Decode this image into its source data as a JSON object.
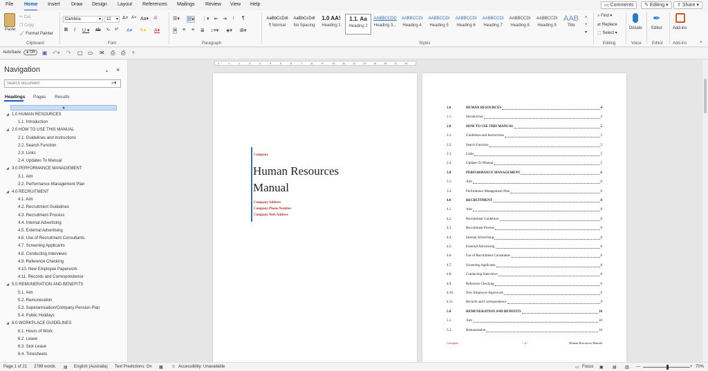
{
  "menus": [
    "File",
    "Home",
    "Insert",
    "Draw",
    "Design",
    "Layout",
    "References",
    "Mailings",
    "Review",
    "View",
    "Help"
  ],
  "top_buttons": {
    "comments": "Comments",
    "editing": "Editing",
    "share": "Share"
  },
  "ribbon": {
    "clipboard": {
      "paste": "Paste",
      "cut": "Cut",
      "copy": "Copy",
      "format_painter": "Format Painter",
      "label": "Clipboard"
    },
    "font": {
      "name": "Cambria",
      "size": "12",
      "label": "Font"
    },
    "paragraph": {
      "label": "Paragraph"
    },
    "styles": {
      "label": "Styles",
      "items": [
        {
          "preview": "AaBbCcDdI",
          "name": "¶ Normal"
        },
        {
          "preview": "AaBbCcDdI",
          "name": "No Spacing"
        },
        {
          "preview": "1.0 AA!",
          "name": "Heading 1"
        },
        {
          "preview": "1.1. Aa",
          "name": "Heading 2"
        },
        {
          "preview": "AABBCCDD",
          "name": "Heading 3..."
        },
        {
          "preview": "AABBCCDI",
          "name": "Heading 4"
        },
        {
          "preview": "AABBCCDI",
          "name": "Heading 5"
        },
        {
          "preview": "AABBCCDI",
          "name": "Heading 6"
        },
        {
          "preview": "AABBCCDI",
          "name": "Heading 7"
        },
        {
          "preview": "AABBCCDI",
          "name": "Heading 8"
        },
        {
          "preview": "AABBCCDI",
          "name": "Heading 9"
        },
        {
          "preview": "AAB",
          "name": "Title"
        }
      ]
    },
    "editing": {
      "find": "Find",
      "replace": "Replace",
      "select": "Select",
      "label": "Editing"
    },
    "voice": {
      "dictate": "Dictate",
      "label": "Voice"
    },
    "editor": {
      "editor": "Editor",
      "label": "Editor"
    },
    "addins": {
      "addins": "Add-ins",
      "label": "Add-ins"
    }
  },
  "qat": {
    "autosave": "AutoSave",
    "toggle": "Off"
  },
  "navigation": {
    "title": "Navigation",
    "search_placeholder": "Search document",
    "tabs": [
      "Headings",
      "Pages",
      "Results"
    ],
    "headings": [
      {
        "text": "1.0 HUMAN RESOURCES",
        "level": 1
      },
      {
        "text": "1.1. Introduction",
        "level": 2
      },
      {
        "text": "2.0 HOW TO USE THIS MANUAL",
        "level": 1
      },
      {
        "text": "2.1. Guidelines and Instructions",
        "level": 2
      },
      {
        "text": "2.2. Search Function",
        "level": 2
      },
      {
        "text": "2.3. Links",
        "level": 2
      },
      {
        "text": "2.4. Updates To Manual",
        "level": 2
      },
      {
        "text": "3.0 PERFORMANCE MANAGEMENT",
        "level": 1
      },
      {
        "text": "3.1. Aim",
        "level": 2
      },
      {
        "text": "3.2. Performance Management Plan",
        "level": 2
      },
      {
        "text": "4.0 RECRUITMENT",
        "level": 1
      },
      {
        "text": "4.1. Aim",
        "level": 2
      },
      {
        "text": "4.2. Recruitment Guidelines",
        "level": 2
      },
      {
        "text": "4.3. Recruitment Process",
        "level": 2
      },
      {
        "text": "4.4. Internal Advertising",
        "level": 2
      },
      {
        "text": "4.5. External Advertising",
        "level": 2
      },
      {
        "text": "4.6. Use of Recruitment Consultants",
        "level": 2
      },
      {
        "text": "4.7. Screening Applicants",
        "level": 2
      },
      {
        "text": "4.8. Conducting Interviews",
        "level": 2
      },
      {
        "text": "4.9. Reference Checking",
        "level": 2
      },
      {
        "text": "4.10. New Employee Paperwork",
        "level": 2
      },
      {
        "text": "4.11. Records  and Correspondence",
        "level": 2
      },
      {
        "text": "5.0 REMUNERATION AND BENEFITS",
        "level": 1
      },
      {
        "text": "5.1. Aim",
        "level": 2
      },
      {
        "text": "5.2. Remuneration",
        "level": 2
      },
      {
        "text": "5.3. Superannuation/Company Pension Plan",
        "level": 2
      },
      {
        "text": "5.4. Public Holidays",
        "level": 2
      },
      {
        "text": "6.0 WORKPLACE  GUIDELINES",
        "level": 1
      },
      {
        "text": "6.1. Hours of Work",
        "level": 2
      },
      {
        "text": "6.2. Leave",
        "level": 2
      },
      {
        "text": "6.3. Sick Leave",
        "level": 2
      },
      {
        "text": "6.4. Timesheets",
        "level": 2
      }
    ]
  },
  "ruler_marks": [
    "2",
    "1",
    "1",
    "2",
    "3",
    "4",
    "5",
    "6",
    "7",
    "8",
    "9",
    "10",
    "11",
    "12",
    "13",
    "14",
    "15",
    "17",
    "18"
  ],
  "cover": {
    "company": "Company",
    "title_line1": "Human Resources",
    "title_line2": "Manual",
    "address": "Company Address",
    "phone": "Company Phone Number",
    "web": "Company Web Address"
  },
  "toc": [
    {
      "num": "1.0",
      "title": "HUMAN RESOURCES",
      "page": "4",
      "bold": true
    },
    {
      "num": "1.1.",
      "title": "Introduction",
      "page": "4",
      "bold": false
    },
    {
      "num": "2.0",
      "title": "HOW TO USE THIS MANUAL",
      "page": "5",
      "bold": true
    },
    {
      "num": "2.1.",
      "title": "Guidelines and Instructions",
      "page": "5",
      "bold": false
    },
    {
      "num": "2.2.",
      "title": "Search Function",
      "page": "5",
      "bold": false
    },
    {
      "num": "2.3.",
      "title": "Links",
      "page": "5",
      "bold": false
    },
    {
      "num": "2.4.",
      "title": "Updates To Manual",
      "page": "5",
      "bold": false
    },
    {
      "num": "3.0",
      "title": "PERFORMANCE MANAGEMENT",
      "page": "6",
      "bold": true
    },
    {
      "num": "3.1.",
      "title": "Aim",
      "page": "6",
      "bold": false
    },
    {
      "num": "3.2.",
      "title": "Performance Management Plan",
      "page": "6",
      "bold": false
    },
    {
      "num": "4.0",
      "title": "RECRUITMENT",
      "page": "8",
      "bold": true
    },
    {
      "num": "4.1.",
      "title": "Aim",
      "page": "8",
      "bold": false
    },
    {
      "num": "4.2.",
      "title": "Recruitment Guidelines",
      "page": "8",
      "bold": false
    },
    {
      "num": "4.3.",
      "title": "Recruitment Process",
      "page": "8",
      "bold": false
    },
    {
      "num": "4.4.",
      "title": "Internal Advertising",
      "page": "8",
      "bold": false
    },
    {
      "num": "4.5.",
      "title": "External Advertising",
      "page": "8",
      "bold": false
    },
    {
      "num": "4.6.",
      "title": "Use of Recruitment Consultants",
      "page": "8",
      "bold": false
    },
    {
      "num": "4.7.",
      "title": "Screening Applicants",
      "page": "8",
      "bold": false
    },
    {
      "num": "4.8.",
      "title": "Conducting Interviews",
      "page": "8",
      "bold": false
    },
    {
      "num": "4.9.",
      "title": "Reference Checking",
      "page": "9",
      "bold": false
    },
    {
      "num": "4.10.",
      "title": "New Employee Paperwork",
      "page": "9",
      "bold": false
    },
    {
      "num": "4.11.",
      "title": "Records  and Correspondence",
      "page": "9",
      "bold": false
    },
    {
      "num": "5.0",
      "title": "REMUNERATION AND BENEFITS",
      "page": "10",
      "bold": true
    },
    {
      "num": "5.1.",
      "title": "Aim",
      "page": "10",
      "bold": false
    },
    {
      "num": "5.2.",
      "title": "Remuneration",
      "page": "10",
      "bold": false
    }
  ],
  "page2_footer": {
    "left": "Company",
    "center": "- 2 -",
    "right": "Human Resources Manual"
  },
  "status": {
    "page": "Page 1 of 21",
    "words": "2789 words",
    "language": "English (Australia)",
    "predictions": "Text Predictions: On",
    "accessibility": "Accessibility: Unavailable",
    "focus": "Focus",
    "zoom": "70%"
  },
  "colors": {
    "accent": "#185abd",
    "cover_red": "#b03030",
    "cover_bar": "#3b6e9e"
  }
}
